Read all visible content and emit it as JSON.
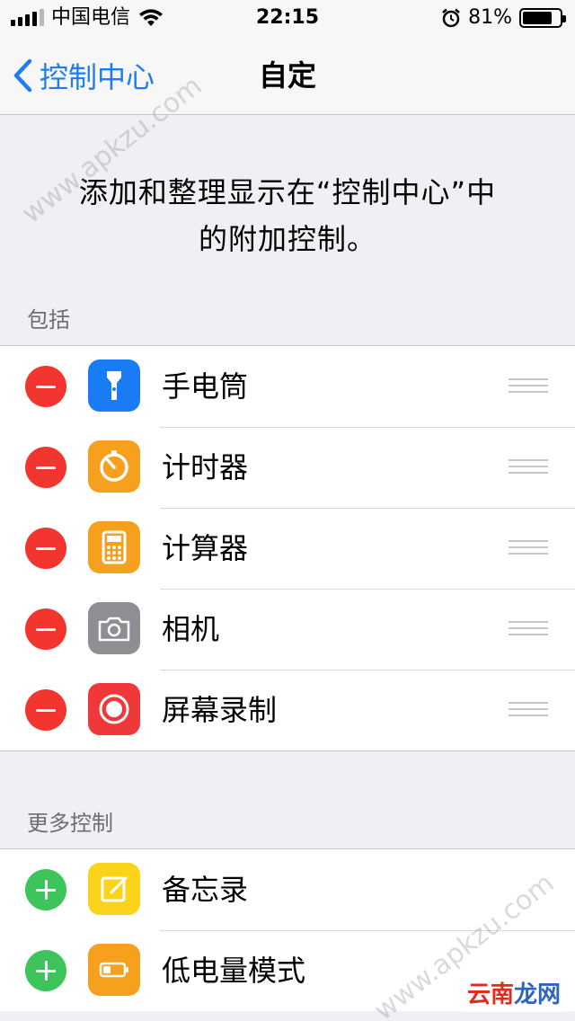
{
  "status_bar": {
    "carrier": "中国电信",
    "time": "22:15",
    "battery_percent": "81%",
    "battery_level": 0.81,
    "icons": [
      "signal-icon",
      "wifi-icon",
      "alarm-icon",
      "battery-icon"
    ]
  },
  "nav": {
    "back_label": "控制中心",
    "title": "自定"
  },
  "description": {
    "line1": "添加和整理显示在“控制中心”中",
    "line2": "的附加控制。"
  },
  "included": {
    "header": "包括",
    "items": [
      {
        "label": "手电筒",
        "icon": "flashlight-icon",
        "color": "#1a7cf5"
      },
      {
        "label": "计时器",
        "icon": "timer-icon",
        "color": "#f7a01d"
      },
      {
        "label": "计算器",
        "icon": "calculator-icon",
        "color": "#f7a01d"
      },
      {
        "label": "相机",
        "icon": "camera-icon",
        "color": "#8e8e93"
      },
      {
        "label": "屏幕录制",
        "icon": "screen-record-icon",
        "color": "#f0383a"
      }
    ]
  },
  "more": {
    "header": "更多控制",
    "items": [
      {
        "label": "备忘录",
        "icon": "notes-icon",
        "color": "#fbd31b"
      },
      {
        "label": "低电量模式",
        "icon": "low-power-icon",
        "color": "#f7a01d"
      }
    ]
  },
  "colors": {
    "accent": "#1f7cf4",
    "remove": "#f2352f",
    "add": "#3dc45a"
  },
  "watermark": {
    "text": "www.apkzu.com",
    "brand_part1": "云南",
    "brand_part2": "龙网"
  }
}
